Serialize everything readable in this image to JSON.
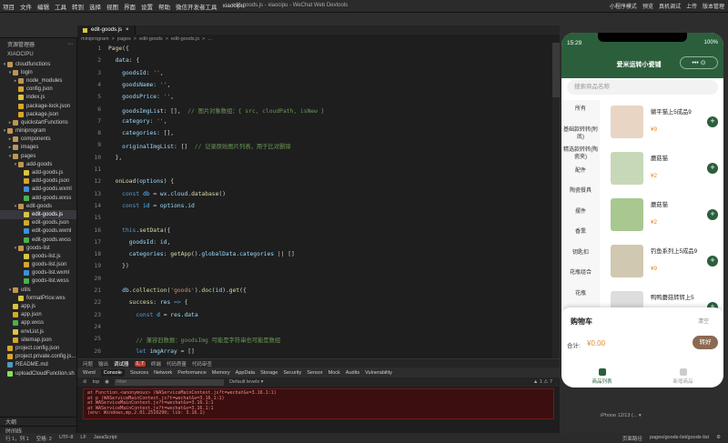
{
  "menu": {
    "items": [
      "项目",
      "文件",
      "编辑",
      "工具",
      "转到",
      "选择",
      "视图",
      "界面",
      "设置",
      "帮助",
      "微信开发者工具",
      "xiaocipu"
    ],
    "window_title": "edit-goods.js - xiaocipu - WeChat Web Devtools",
    "right": [
      "小程序模式",
      "预览",
      "真机调试",
      "上传",
      "版本管理"
    ]
  },
  "sidebar": {
    "header": "资源管理器",
    "project": "XIAOCIPU",
    "tree": [
      {
        "d": 0,
        "a": "▾",
        "t": "folder",
        "n": "cloudfunctions"
      },
      {
        "d": 1,
        "a": "▾",
        "t": "folder",
        "n": "login"
      },
      {
        "d": 2,
        "a": "▸",
        "t": "folder",
        "n": "node_modules"
      },
      {
        "d": 2,
        "a": "",
        "t": "json",
        "n": "config.json"
      },
      {
        "d": 2,
        "a": "",
        "t": "js",
        "n": "index.js"
      },
      {
        "d": 2,
        "a": "",
        "t": "json",
        "n": "package-lock.json"
      },
      {
        "d": 2,
        "a": "",
        "t": "json",
        "n": "package.json"
      },
      {
        "d": 1,
        "a": "▸",
        "t": "folder",
        "n": "quickstartFunctions"
      },
      {
        "d": 0,
        "a": "▾",
        "t": "folder",
        "n": "miniprogram"
      },
      {
        "d": 1,
        "a": "▸",
        "t": "folder",
        "n": "components"
      },
      {
        "d": 1,
        "a": "▸",
        "t": "folder",
        "n": "images"
      },
      {
        "d": 1,
        "a": "▾",
        "t": "folder",
        "n": "pages"
      },
      {
        "d": 2,
        "a": "▾",
        "t": "folder",
        "n": "add-goods"
      },
      {
        "d": 3,
        "a": "",
        "t": "js",
        "n": "add-goods.js"
      },
      {
        "d": 3,
        "a": "",
        "t": "json",
        "n": "add-goods.json"
      },
      {
        "d": 3,
        "a": "",
        "t": "wxml",
        "n": "add-goods.wxml"
      },
      {
        "d": 3,
        "a": "",
        "t": "wxss",
        "n": "add-goods.wxss"
      },
      {
        "d": 2,
        "a": "▾",
        "t": "folder",
        "n": "edit-goods"
      },
      {
        "d": 3,
        "a": "",
        "t": "js",
        "n": "edit-goods.js",
        "active": true
      },
      {
        "d": 3,
        "a": "",
        "t": "json",
        "n": "edit-goods.json"
      },
      {
        "d": 3,
        "a": "",
        "t": "wxml",
        "n": "edit-goods.wxml"
      },
      {
        "d": 3,
        "a": "",
        "t": "wxss",
        "n": "edit-goods.wxss"
      },
      {
        "d": 2,
        "a": "▾",
        "t": "folder",
        "n": "goods-list"
      },
      {
        "d": 3,
        "a": "",
        "t": "js",
        "n": "goods-list.js"
      },
      {
        "d": 3,
        "a": "",
        "t": "json",
        "n": "goods-list.json"
      },
      {
        "d": 3,
        "a": "",
        "t": "wxml",
        "n": "goods-list.wxml"
      },
      {
        "d": 3,
        "a": "",
        "t": "wxss",
        "n": "goods-list.wxss"
      },
      {
        "d": 1,
        "a": "▾",
        "t": "folder",
        "n": "utils"
      },
      {
        "d": 2,
        "a": "",
        "t": "js",
        "n": "formatPrice.wxs"
      },
      {
        "d": 1,
        "a": "",
        "t": "js",
        "n": "app.js"
      },
      {
        "d": 1,
        "a": "",
        "t": "json",
        "n": "app.json"
      },
      {
        "d": 1,
        "a": "",
        "t": "wxss",
        "n": "app.wxss"
      },
      {
        "d": 1,
        "a": "",
        "t": "js",
        "n": "envList.js"
      },
      {
        "d": 1,
        "a": "",
        "t": "json",
        "n": "sitemap.json"
      },
      {
        "d": 0,
        "a": "",
        "t": "json",
        "n": "project.config.json"
      },
      {
        "d": 0,
        "a": "",
        "t": "json",
        "n": "project.private.config.js..."
      },
      {
        "d": 0,
        "a": "",
        "t": "md",
        "n": "README.md"
      },
      {
        "d": 0,
        "a": "",
        "t": "sh",
        "n": "uploadCloudFunction.sh"
      }
    ],
    "footer": [
      "大纲",
      "时间线"
    ]
  },
  "editor": {
    "tab": "edit-goods.js",
    "breadcrumb": [
      "miniprogram",
      ">",
      "pages",
      ">",
      "edit-goods",
      ">",
      "edit-goods.js",
      ">",
      "..."
    ],
    "lines": [
      "<span class='f'>Page</span>({",
      "  <span class='p'>data</span>: {",
      "    <span class='p'>goodsId</span>: <span class='s'>''</span>,",
      "    <span class='p'>goodsName</span>: <span class='s'>''</span>,",
      "    <span class='p'>goodsPrice</span>: <span class='s'>''</span>,",
      "    <span class='p'>goodsImgList</span>: [],  <span class='c'>// 图片对象数组：{ src, cloudPath, isNew }</span>",
      "    <span class='p'>category</span>: <span class='s'>''</span>,",
      "    <span class='p'>categories</span>: [],",
      "    <span class='p'>originalImgList</span>: []  <span class='c'>// 记录原始图片列表，用于比对删除</span>",
      "  },",
      "",
      "  <span class='f'>onLoad</span>(<span class='p'>options</span>) {",
      "    <span class='k'>const</span> <span class='v'>db</span> = <span class='p'>wx</span>.<span class='p'>cloud</span>.<span class='f'>database</span>()",
      "    <span class='k'>const</span> <span class='v'>id</span> = <span class='p'>options</span>.<span class='p'>id</span>",
      "",
      "    <span class='k'>this</span>.<span class='f'>setData</span>({",
      "      <span class='p'>goodsId</span>: <span class='p'>id</span>,",
      "      <span class='p'>categories</span>: <span class='f'>getApp</span>().<span class='p'>globalData</span>.<span class='p'>categories</span> || []",
      "    })",
      "",
      "    <span class='p'>db</span>.<span class='f'>collection</span>(<span class='s'>'goods'</span>).<span class='f'>doc</span>(<span class='p'>id</span>).<span class='f'>get</span>({",
      "      <span class='f'>success</span>: <span class='p'>res</span> <span class='k'>=></span> {",
      "        <span class='k'>const</span> <span class='v'>d</span> = <span class='p'>res</span>.<span class='p'>data</span>",
      "",
      "        <span class='c'>// 兼容旧数据：goodsImg 可能是字符串也可能是数组</span>",
      "        <span class='k'>let</span> <span class='p'>imgArray</span> = []"
    ]
  },
  "panel": {
    "tabs": [
      "问题",
      "输出",
      "调试器",
      "终端",
      "代码质量",
      "代码审查"
    ],
    "active_tab": "调试器",
    "active_badge": "1, 7",
    "devtabs": [
      "Wxml",
      "Console",
      "Sources",
      "Network",
      "Performance",
      "Memory",
      "AppData",
      "Storage",
      "Security",
      "Sensor",
      "Mock",
      "Audits",
      "Vulnerability"
    ],
    "active_devtab": "Console",
    "context": "top",
    "filter_placeholder": "Filter",
    "levels": "Default levels ▾",
    "counts": "▲ 1  ⚠ 7",
    "errors": [
      "    at Function.<anonymous> (WAServiceMainContext.js?t=wechat&v=3.16.1:1)",
      "    at p (WAServiceMainContext.js?t=wechat&v=3.16.1:1)",
      "    at WAServiceMainContext.js?t=wechat&v=3.16.1:1",
      "    at WAServiceMainContext.js?t=wechat&v=3.16.1:1",
      "  (env: Windows,mp,2.01.2510290; lib: 3.16.1)"
    ]
  },
  "status": {
    "left": [
      "行 1，列 1",
      "空格: 2",
      "UTF-8",
      "LF",
      "JavaScript"
    ],
    "right": [
      "页面路径",
      "pages/goods-list/goods-list",
      "⚙"
    ]
  },
  "phone": {
    "time": "15:29",
    "battery": "100%",
    "title": "爱米运转小瓷铺",
    "capsule": "••• ⊙",
    "search_placeholder": "搜索商品名称",
    "categories": [
      "所有",
      "基础款转转(附底)",
      "精选款转转(陶瓷夹)",
      "配件",
      "陶瓷餐具",
      "摆件",
      "香熏",
      "钥匙扣",
      "花瓶组合",
      "花瓶"
    ],
    "goods": [
      {
        "name": "躺平猫上5成品9",
        "price": "¥9",
        "color": "#e8d5c4"
      },
      {
        "name": "蘑菇猫",
        "price": "¥2",
        "color": "#c7d8b8"
      },
      {
        "name": "蘑菇猫",
        "price": "¥2",
        "color": "#a8c890"
      },
      {
        "name": "钓鱼系列上5成品9",
        "price": "¥9",
        "color": "#d0c8b0"
      },
      {
        "name": "鸭鸭蘑菇转转上5",
        "price": "¥9",
        "color": "#ddd"
      }
    ],
    "cart_title": "购物车",
    "clear": "清空",
    "total_label": "合计:",
    "total": "¥0.00",
    "checkout": "转好",
    "tabbar": [
      "商品列表",
      "新增商品"
    ]
  },
  "device": "iPhone 12/13 (... ▾",
  "colors": {
    "brand_green": "#2b5f3c",
    "price_orange": "#e0892a"
  }
}
